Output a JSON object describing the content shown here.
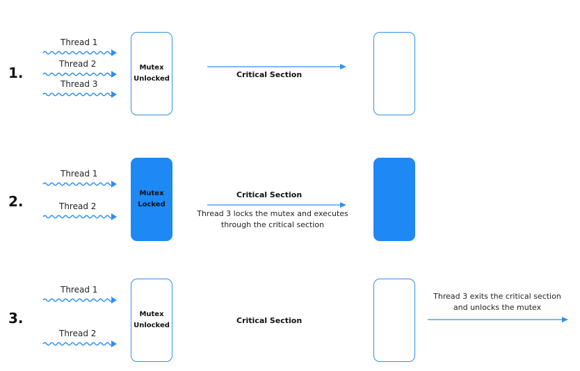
{
  "rows": [
    {
      "number": "1.",
      "threads": [
        "Thread 1",
        "Thread 2",
        "Thread 3"
      ],
      "mutex_label": "Mutex\nUnlocked",
      "critical_label": "Critical Section",
      "mutex_locked": false
    },
    {
      "number": "2.",
      "threads": [
        "Thread 1",
        "Thread 2"
      ],
      "mutex_label": "Mutex\nLocked",
      "critical_label": "Critical Section",
      "note": "Thread 3 locks the mutex and executes\nthrough the critical section",
      "mutex_locked": true
    },
    {
      "number": "3.",
      "threads": [
        "Thread 1",
        "Thread 2"
      ],
      "mutex_label": "Mutex\nUnlocked",
      "critical_label": "Critical Section",
      "exit_note": "Thread 3 exits the critical section\nand unlocks the mutex",
      "mutex_locked": false
    }
  ],
  "colors": {
    "accent": "#1e88f5",
    "outline": "#2f8ff0"
  }
}
